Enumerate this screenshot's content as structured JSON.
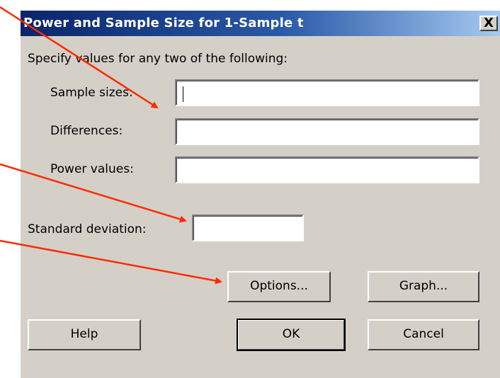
{
  "dialog": {
    "title": "Power and Sample Size for 1-Sample t",
    "close_label": "X",
    "instruction": "Specify values for any two of the following:",
    "fields": {
      "sample_sizes_label": "Sample sizes:",
      "sample_sizes_value": "",
      "differences_label": "Differences:",
      "differences_value": "",
      "power_values_label": "Power values:",
      "power_values_value": ""
    },
    "std_dev_label": "Standard deviation:",
    "std_dev_value": "",
    "buttons": {
      "options": "Options...",
      "graph": "Graph...",
      "help": "Help",
      "ok": "OK",
      "cancel": "Cancel"
    }
  },
  "colors": {
    "dialog_bg": "#d4d0c8",
    "title_gradient_start": "#0a246a",
    "title_gradient_end": "#a6caf0",
    "annotation_arrow": "#ff2a00"
  }
}
